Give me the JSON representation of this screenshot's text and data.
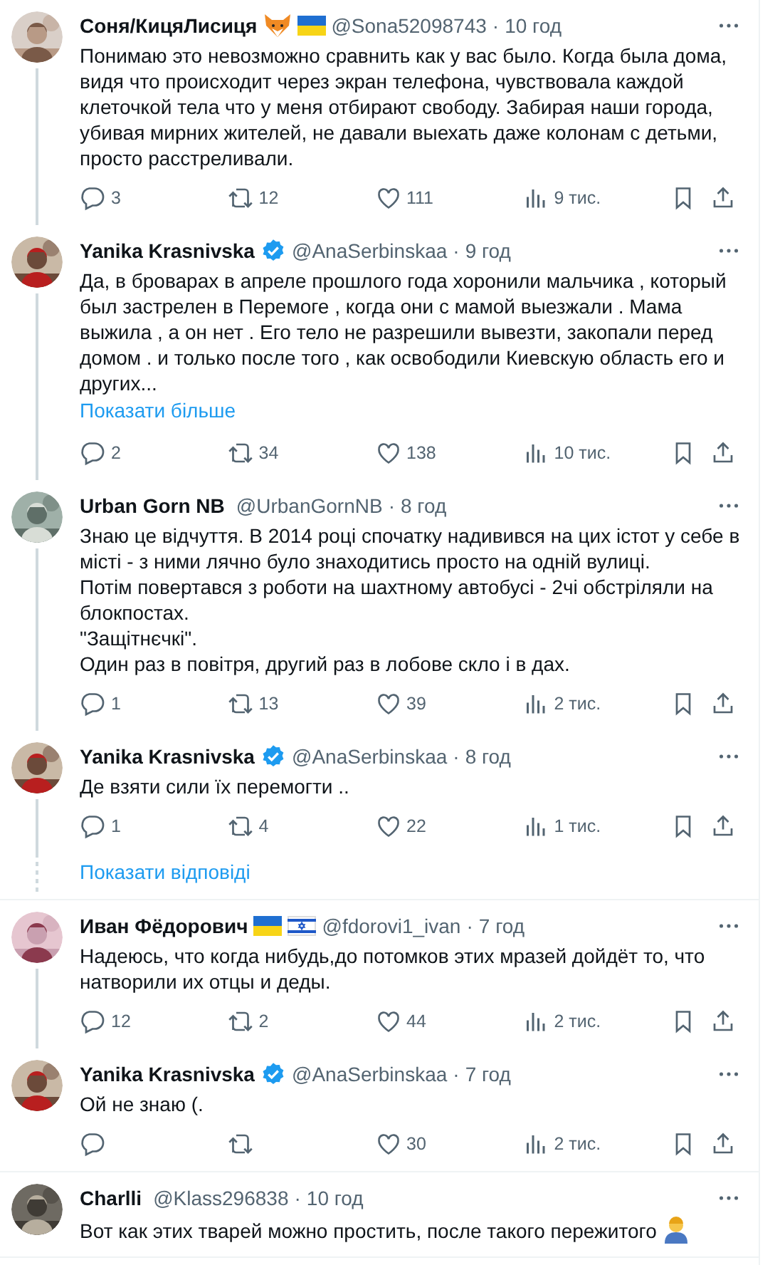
{
  "threads": [
    {
      "tweets": [
        {
          "name": "Соня/КицяЛисиця",
          "name_icons": [
            {
              "kind": "fox"
            },
            {
              "kind": "flag_ua"
            }
          ],
          "verified": false,
          "handle": "@Sona52098743",
          "separator": "·",
          "time": "10 год",
          "text": "Понимаю это невозможно сравнить как у вас было. Когда была дома, видя что происходит через экран телефона, чувствовала каждой клеточкой тела что у меня отбирают свободу. Забирая наши города, убивая мирних жителей, не давали выехать даже колонам с детьми, просто расстреливали.",
          "stats": {
            "replies": "3",
            "reposts": "12",
            "likes": "111",
            "views": "9 тис."
          }
        },
        {
          "name": "Yanika Krasnivska",
          "verified": true,
          "handle": "@AnaSerbinskaa",
          "separator": "·",
          "time": "9 год",
          "text": "Да, в броварах в апреле прошлого года хоронили мальчика , который был застрелен в Перемоге , когда они с мамой выезжали . Мама выжила , а он нет . Его тело не разрешили вывезти, закопали перед домом .  и только после того , как освободили Киевскую область его и других...",
          "show_more": "Показати більше",
          "stats": {
            "replies": "2",
            "reposts": "34",
            "likes": "138",
            "views": "10 тис."
          }
        },
        {
          "name": "Urban Gorn NB",
          "verified": false,
          "handle": "@UrbanGornNB",
          "separator": "·",
          "time": "8 год",
          "text": "Знаю це відчуття. В 2014 році спочатку надивився на цих істот у себе в місті - з ними лячно було знаходитись просто на одній вулиці.\nПотім повертався з роботи на шахтному автобусі - 2чі обстріляли на блокпостах.\n\"Защітнєчкі\".\nОдин раз в повітря, другий раз в лобове скло і в дах.",
          "stats": {
            "replies": "1",
            "reposts": "13",
            "likes": "39",
            "views": "2 тис."
          }
        },
        {
          "name": "Yanika Krasnivska",
          "verified": true,
          "handle": "@AnaSerbinskaa",
          "separator": "·",
          "time": "8 год",
          "text": "Де взяти сили їх перемогти ..",
          "stats": {
            "replies": "1",
            "reposts": "4",
            "likes": "22",
            "views": "1 тис."
          }
        }
      ],
      "show_replies": "Показати відповіді"
    },
    {
      "tweets": [
        {
          "name": "Иван Фёдорович",
          "name_icons": [
            {
              "kind": "flag_ua"
            },
            {
              "kind": "flag_il"
            }
          ],
          "verified": false,
          "handle": "@fdorovi1_ivan",
          "separator": "·",
          "time": "7 год",
          "text": "Надеюсь, что когда нибудь,до потомков этих мразей дойдёт то, что натворили их отцы и деды.",
          "stats": {
            "replies": "12",
            "reposts": "2",
            "likes": "44",
            "views": "2 тис."
          }
        },
        {
          "name": "Yanika Krasnivska",
          "verified": true,
          "handle": "@AnaSerbinskaa",
          "separator": "·",
          "time": "7 год",
          "text": "Ой не знаю (.",
          "stats": {
            "likes": "30",
            "views": "2 тис."
          }
        }
      ]
    },
    {
      "tweets": [
        {
          "name": "Charlli",
          "verified": false,
          "handle": "@Klass296838",
          "separator": "·",
          "time": "10 год",
          "text": "Вот как этих тварей можно простить, после такого пережитого",
          "text_icon": {
            "kind": "person"
          }
        }
      ]
    }
  ]
}
